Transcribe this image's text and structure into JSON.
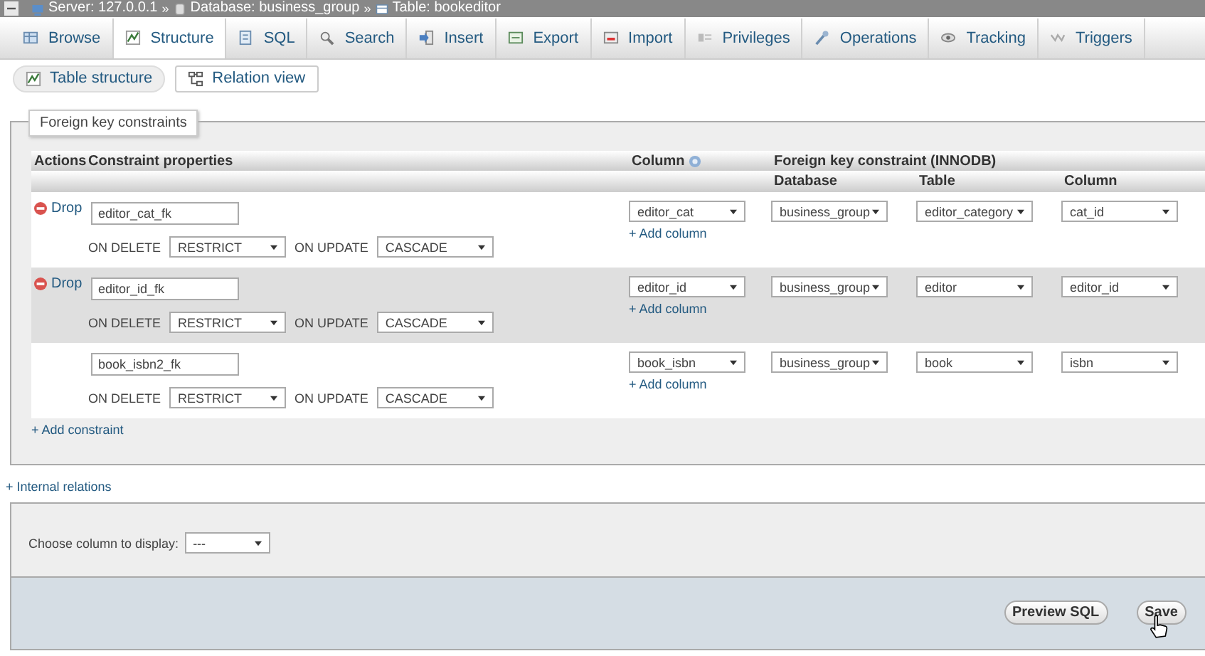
{
  "breadcrumb": [
    {
      "kind": "server",
      "label": "Server: 127.0.0.1",
      "separator": "»"
    },
    {
      "kind": "database",
      "label": "Database: business_group",
      "separator": "»"
    },
    {
      "kind": "table",
      "label": "Table: bookeditor"
    }
  ],
  "tabs": [
    {
      "kind": "browse",
      "label": "Browse",
      "selected": false
    },
    {
      "kind": "structure",
      "label": "Structure",
      "selected": true
    },
    {
      "kind": "sql",
      "label": "SQL",
      "selected": false
    },
    {
      "kind": "search",
      "label": "Search",
      "selected": false
    },
    {
      "kind": "insert",
      "label": "Insert",
      "selected": false
    },
    {
      "kind": "export",
      "label": "Export",
      "selected": false
    },
    {
      "kind": "import",
      "label": "Import",
      "selected": false
    },
    {
      "kind": "privileges",
      "label": "Privileges",
      "selected": false
    },
    {
      "kind": "operations",
      "label": "Operations",
      "selected": false
    },
    {
      "kind": "tracking",
      "label": "Tracking",
      "selected": false
    },
    {
      "kind": "triggers",
      "label": "Triggers",
      "selected": false
    }
  ],
  "subtabs": [
    {
      "kind": "structure",
      "label": "Table structure",
      "selected": false
    },
    {
      "kind": "relation",
      "label": "Relation view",
      "selected": true
    }
  ],
  "foreign_keys": {
    "legend": "Foreign key constraints",
    "headers": {
      "actions": "Actions",
      "properties": "Constraint properties",
      "column": "Column",
      "constraint": "Foreign key constraint (INNODB)",
      "database": "Database",
      "table": "Table",
      "ref_column": "Column"
    },
    "rows": [
      {
        "drop": "Drop",
        "name": "editor_cat_fk",
        "on_delete_label": "ON DELETE",
        "on_delete": "RESTRICT",
        "on_update_label": "ON UPDATE",
        "on_update": "CASCADE",
        "column": "editor_cat",
        "add_column": "+ Add column",
        "database": "business_group",
        "table": "editor_category",
        "ref_column": "cat_id"
      },
      {
        "drop": "Drop",
        "name": "editor_id_fk",
        "on_delete_label": "ON DELETE",
        "on_delete": "RESTRICT",
        "on_update_label": "ON UPDATE",
        "on_update": "CASCADE",
        "column": "editor_id",
        "add_column": "+ Add column",
        "database": "business_group",
        "table": "editor",
        "ref_column": "editor_id"
      },
      {
        "name": "book_isbn2_fk",
        "on_delete_label": "ON DELETE",
        "on_delete": "RESTRICT",
        "on_update_label": "ON UPDATE",
        "on_update": "CASCADE",
        "column": "book_isbn",
        "add_column": "+ Add column",
        "database": "business_group",
        "table": "book",
        "ref_column": "isbn"
      }
    ],
    "add_constraint": "+ Add constraint"
  },
  "internal_relations": "+ Internal relations",
  "display_column": {
    "label": "Choose column to display:",
    "value": "---"
  },
  "buttons": [
    "Preview SQL",
    "Save"
  ]
}
